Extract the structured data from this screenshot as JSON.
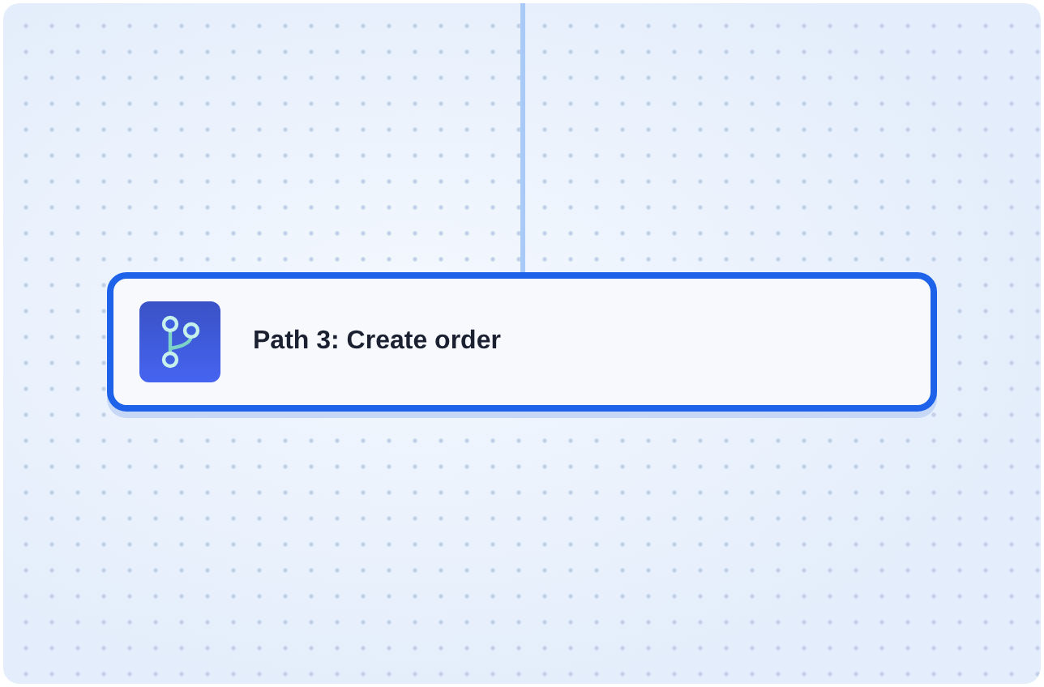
{
  "node": {
    "title": "Path 3: Create order",
    "selected": true
  }
}
